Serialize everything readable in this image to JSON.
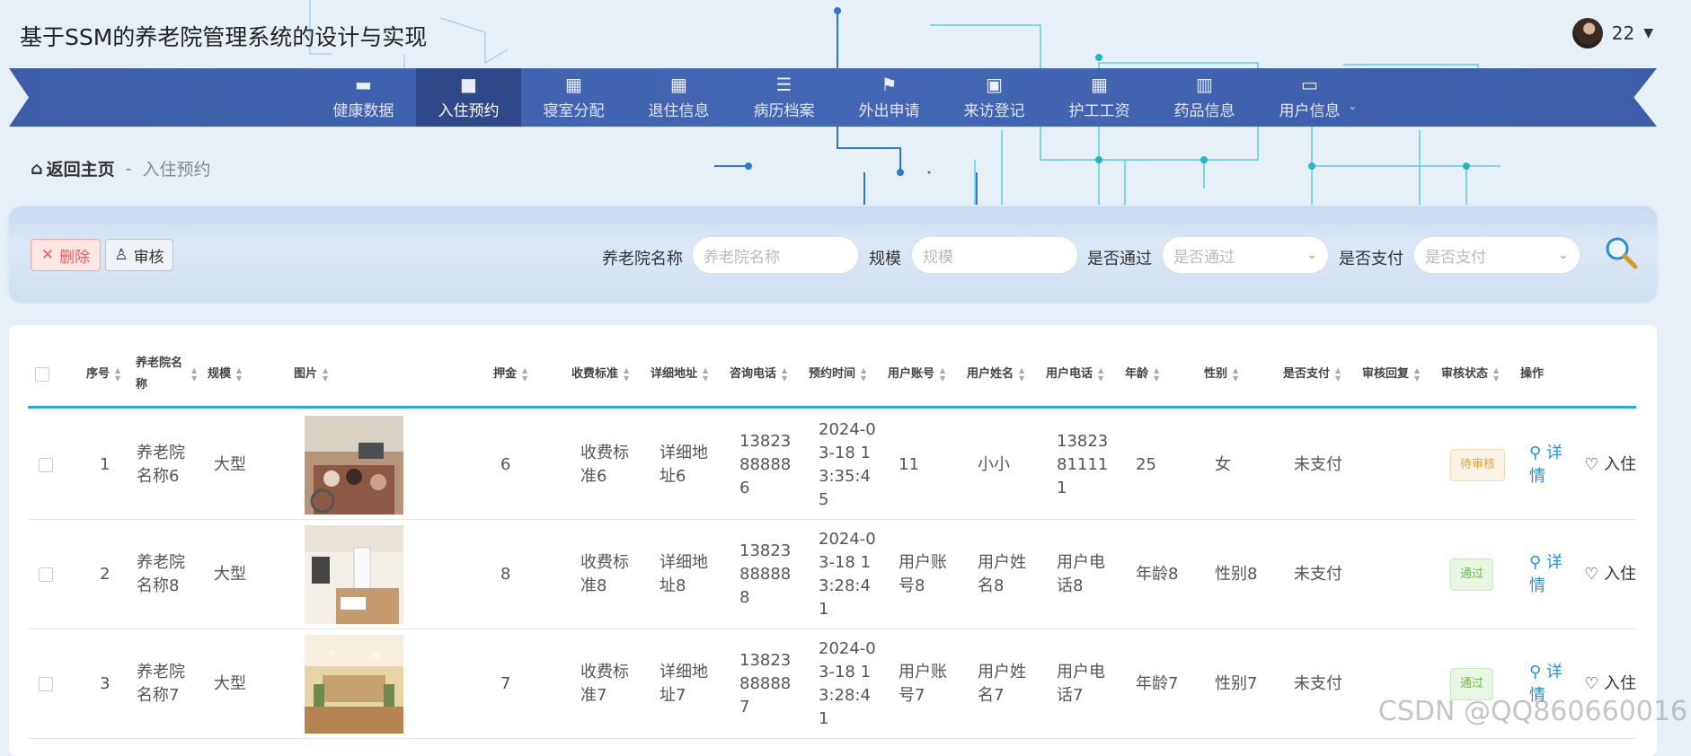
{
  "app": {
    "title": "基于SSM的养老院管理系统的设计与实现"
  },
  "user": {
    "name": "22"
  },
  "nav": {
    "items": [
      {
        "label": "健康数据",
        "icon": "monitor-icon",
        "glyph": "▬"
      },
      {
        "label": "入住预约",
        "icon": "briefcase-icon",
        "glyph": "■",
        "active": true
      },
      {
        "label": "寝室分配",
        "icon": "grid-icon",
        "glyph": "▦"
      },
      {
        "label": "退住信息",
        "icon": "grid-icon",
        "glyph": "▦"
      },
      {
        "label": "病历档案",
        "icon": "list-icon",
        "glyph": "☰"
      },
      {
        "label": "外出申请",
        "icon": "flag-icon",
        "glyph": "⚑"
      },
      {
        "label": "来访登记",
        "icon": "clipboard-icon",
        "glyph": "▣"
      },
      {
        "label": "护工工资",
        "icon": "grid-icon",
        "glyph": "▦"
      },
      {
        "label": "药品信息",
        "icon": "books-icon",
        "glyph": "▥"
      },
      {
        "label": "用户信息",
        "icon": "card-icon",
        "glyph": "▭",
        "has_sub": true
      }
    ]
  },
  "breadcrumb": {
    "home": "返回主页",
    "separator": "-",
    "current": "入住预约"
  },
  "toolbar": {
    "delete_label": "删除",
    "audit_label": "审核"
  },
  "search": {
    "name_label": "养老院名称",
    "name_placeholder": "养老院名称",
    "scale_label": "规模",
    "scale_placeholder": "规模",
    "passed_label": "是否通过",
    "passed_placeholder": "是否通过",
    "paid_label": "是否支付",
    "paid_placeholder": "是否支付"
  },
  "table": {
    "headers": {
      "seq": "序号",
      "name": "养老院名称",
      "scale": "规模",
      "image": "图片",
      "deposit": "押金",
      "fee": "收费标准",
      "address": "详细地址",
      "phone": "咨询电话",
      "time": "预约时间",
      "account": "用户账号",
      "uname": "用户姓名",
      "uphone": "用户电话",
      "age": "年龄",
      "gender": "性别",
      "paid": "是否支付",
      "reply": "审核回复",
      "status": "审核状态",
      "ops": "操作"
    },
    "detail_label": "详情",
    "checkin_label": "入住",
    "rows": [
      {
        "seq": "1",
        "name": "养老院名称6",
        "scale": "大型",
        "deposit": "6",
        "fee": "收费标准6",
        "address": "详细地址6",
        "phone": "13823888886",
        "time": "2024-03-18 13:35:45",
        "account": "11",
        "uname": "小小",
        "uphone": "13823811111",
        "age": "25",
        "gender": "女",
        "paid": "未支付",
        "reply": "",
        "status": "待审核",
        "status_type": "pending"
      },
      {
        "seq": "2",
        "name": "养老院名称8",
        "scale": "大型",
        "deposit": "8",
        "fee": "收费标准8",
        "address": "详细地址8",
        "phone": "13823888888",
        "time": "2024-03-18 13:28:41",
        "account": "用户账号8",
        "uname": "用户姓名8",
        "uphone": "用户电话8",
        "age": "年龄8",
        "gender": "性别8",
        "paid": "未支付",
        "reply": "",
        "status": "通过",
        "status_type": "pass"
      },
      {
        "seq": "3",
        "name": "养老院名称7",
        "scale": "大型",
        "deposit": "7",
        "fee": "收费标准7",
        "address": "详细地址7",
        "phone": "13823888887",
        "time": "2024-03-18 13:28:41",
        "account": "用户账号7",
        "uname": "用户姓名7",
        "uphone": "用户电话7",
        "age": "年龄7",
        "gender": "性别7",
        "paid": "未支付",
        "reply": "",
        "status": "通过",
        "status_type": "pass"
      }
    ]
  },
  "watermark": "CSDN @QQ860660016"
}
